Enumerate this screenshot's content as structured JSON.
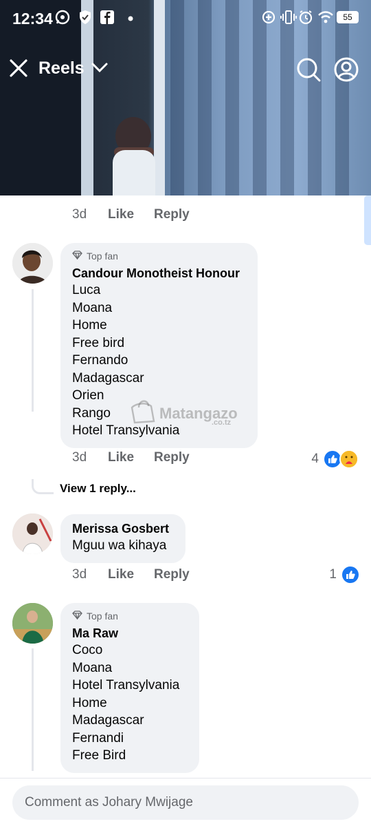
{
  "status_bar": {
    "time": "12:34",
    "battery": "55"
  },
  "nav": {
    "title": "Reels"
  },
  "comments": [
    {
      "time": "3d",
      "like_label": "Like",
      "reply_label": "Reply"
    },
    {
      "badge": "Top fan",
      "author": "Candour Monotheist Honour",
      "lines": [
        "Luca",
        "Moana",
        "Home",
        "Free bird",
        "Fernando",
        "Madagascar",
        "Orien",
        "Rango",
        "Hotel Transylvania"
      ],
      "time": "3d",
      "like_label": "Like",
      "reply_label": "Reply",
      "reaction_count": "4",
      "view_replies": "View 1 reply..."
    },
    {
      "author": "Merissa Gosbert",
      "lines": [
        "Mguu wa kihaya"
      ],
      "time": "3d",
      "like_label": "Like",
      "reply_label": "Reply",
      "reaction_count": "1"
    },
    {
      "badge": "Top fan",
      "author": "Ma Raw",
      "lines": [
        "Coco",
        "Moana",
        "Hotel Transylvania",
        "Home",
        "Madagascar",
        "Fernandi",
        "Free Bird"
      ]
    }
  ],
  "watermark": {
    "text": "Matangazo",
    "sub": ".co.tz"
  },
  "composer": {
    "placeholder": "Comment as Johary Mwijage"
  },
  "colors": {
    "accent": "#1877f2",
    "bubble": "#f0f2f5",
    "muted": "#65676b"
  }
}
